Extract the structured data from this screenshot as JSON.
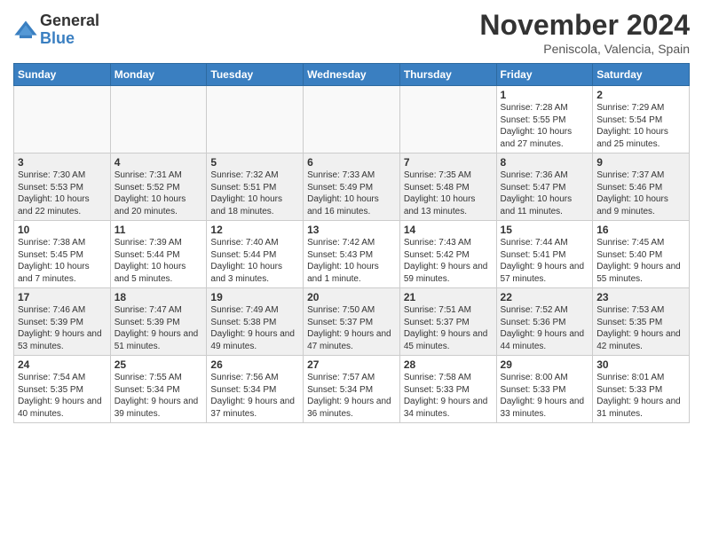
{
  "logo": {
    "general": "General",
    "blue": "Blue"
  },
  "header": {
    "month": "November 2024",
    "location": "Peniscola, Valencia, Spain"
  },
  "weekdays": [
    "Sunday",
    "Monday",
    "Tuesday",
    "Wednesday",
    "Thursday",
    "Friday",
    "Saturday"
  ],
  "weeks": [
    [
      {
        "day": "",
        "info": ""
      },
      {
        "day": "",
        "info": ""
      },
      {
        "day": "",
        "info": ""
      },
      {
        "day": "",
        "info": ""
      },
      {
        "day": "",
        "info": ""
      },
      {
        "day": "1",
        "info": "Sunrise: 7:28 AM\nSunset: 5:55 PM\nDaylight: 10 hours and 27 minutes."
      },
      {
        "day": "2",
        "info": "Sunrise: 7:29 AM\nSunset: 5:54 PM\nDaylight: 10 hours and 25 minutes."
      }
    ],
    [
      {
        "day": "3",
        "info": "Sunrise: 7:30 AM\nSunset: 5:53 PM\nDaylight: 10 hours and 22 minutes."
      },
      {
        "day": "4",
        "info": "Sunrise: 7:31 AM\nSunset: 5:52 PM\nDaylight: 10 hours and 20 minutes."
      },
      {
        "day": "5",
        "info": "Sunrise: 7:32 AM\nSunset: 5:51 PM\nDaylight: 10 hours and 18 minutes."
      },
      {
        "day": "6",
        "info": "Sunrise: 7:33 AM\nSunset: 5:49 PM\nDaylight: 10 hours and 16 minutes."
      },
      {
        "day": "7",
        "info": "Sunrise: 7:35 AM\nSunset: 5:48 PM\nDaylight: 10 hours and 13 minutes."
      },
      {
        "day": "8",
        "info": "Sunrise: 7:36 AM\nSunset: 5:47 PM\nDaylight: 10 hours and 11 minutes."
      },
      {
        "day": "9",
        "info": "Sunrise: 7:37 AM\nSunset: 5:46 PM\nDaylight: 10 hours and 9 minutes."
      }
    ],
    [
      {
        "day": "10",
        "info": "Sunrise: 7:38 AM\nSunset: 5:45 PM\nDaylight: 10 hours and 7 minutes."
      },
      {
        "day": "11",
        "info": "Sunrise: 7:39 AM\nSunset: 5:44 PM\nDaylight: 10 hours and 5 minutes."
      },
      {
        "day": "12",
        "info": "Sunrise: 7:40 AM\nSunset: 5:44 PM\nDaylight: 10 hours and 3 minutes."
      },
      {
        "day": "13",
        "info": "Sunrise: 7:42 AM\nSunset: 5:43 PM\nDaylight: 10 hours and 1 minute."
      },
      {
        "day": "14",
        "info": "Sunrise: 7:43 AM\nSunset: 5:42 PM\nDaylight: 9 hours and 59 minutes."
      },
      {
        "day": "15",
        "info": "Sunrise: 7:44 AM\nSunset: 5:41 PM\nDaylight: 9 hours and 57 minutes."
      },
      {
        "day": "16",
        "info": "Sunrise: 7:45 AM\nSunset: 5:40 PM\nDaylight: 9 hours and 55 minutes."
      }
    ],
    [
      {
        "day": "17",
        "info": "Sunrise: 7:46 AM\nSunset: 5:39 PM\nDaylight: 9 hours and 53 minutes."
      },
      {
        "day": "18",
        "info": "Sunrise: 7:47 AM\nSunset: 5:39 PM\nDaylight: 9 hours and 51 minutes."
      },
      {
        "day": "19",
        "info": "Sunrise: 7:49 AM\nSunset: 5:38 PM\nDaylight: 9 hours and 49 minutes."
      },
      {
        "day": "20",
        "info": "Sunrise: 7:50 AM\nSunset: 5:37 PM\nDaylight: 9 hours and 47 minutes."
      },
      {
        "day": "21",
        "info": "Sunrise: 7:51 AM\nSunset: 5:37 PM\nDaylight: 9 hours and 45 minutes."
      },
      {
        "day": "22",
        "info": "Sunrise: 7:52 AM\nSunset: 5:36 PM\nDaylight: 9 hours and 44 minutes."
      },
      {
        "day": "23",
        "info": "Sunrise: 7:53 AM\nSunset: 5:35 PM\nDaylight: 9 hours and 42 minutes."
      }
    ],
    [
      {
        "day": "24",
        "info": "Sunrise: 7:54 AM\nSunset: 5:35 PM\nDaylight: 9 hours and 40 minutes."
      },
      {
        "day": "25",
        "info": "Sunrise: 7:55 AM\nSunset: 5:34 PM\nDaylight: 9 hours and 39 minutes."
      },
      {
        "day": "26",
        "info": "Sunrise: 7:56 AM\nSunset: 5:34 PM\nDaylight: 9 hours and 37 minutes."
      },
      {
        "day": "27",
        "info": "Sunrise: 7:57 AM\nSunset: 5:34 PM\nDaylight: 9 hours and 36 minutes."
      },
      {
        "day": "28",
        "info": "Sunrise: 7:58 AM\nSunset: 5:33 PM\nDaylight: 9 hours and 34 minutes."
      },
      {
        "day": "29",
        "info": "Sunrise: 8:00 AM\nSunset: 5:33 PM\nDaylight: 9 hours and 33 minutes."
      },
      {
        "day": "30",
        "info": "Sunrise: 8:01 AM\nSunset: 5:33 PM\nDaylight: 9 hours and 31 minutes."
      }
    ]
  ]
}
